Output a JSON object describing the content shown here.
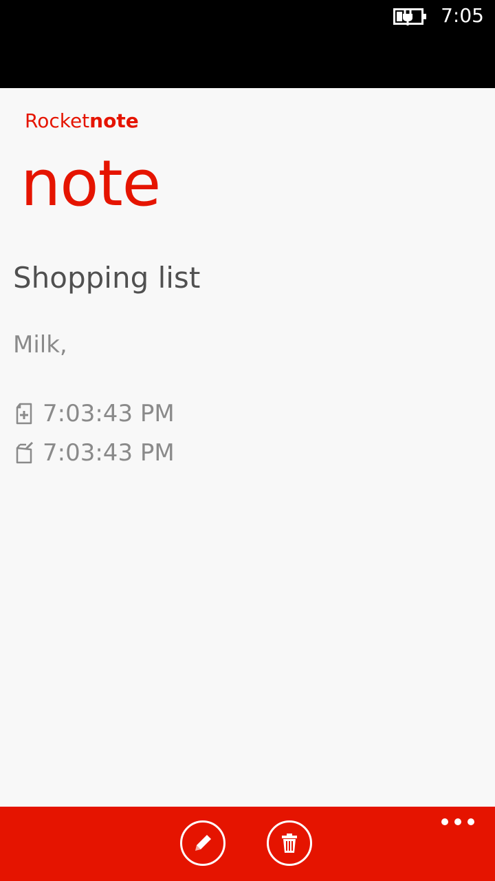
{
  "status_bar": {
    "time": "7:05",
    "battery_icon": "battery-charging-icon"
  },
  "header": {
    "app_name_regular": "Rocket",
    "app_name_bold": "note",
    "page_title": "note"
  },
  "note": {
    "title": "Shopping list",
    "body": "Milk,",
    "created": "7:03:43 PM",
    "created_icon": "document-add-icon",
    "modified": "7:03:43 PM",
    "modified_icon": "document-edit-icon"
  },
  "app_bar": {
    "buttons": [
      {
        "icon": "pencil-icon",
        "action": "edit"
      },
      {
        "icon": "trash-icon",
        "action": "delete"
      }
    ],
    "more_icon": "more-dots-icon"
  },
  "colors": {
    "accent": "#e51400",
    "background": "#f8f8f8",
    "title_text": "#505050",
    "secondary_text": "#8a8a8a"
  }
}
